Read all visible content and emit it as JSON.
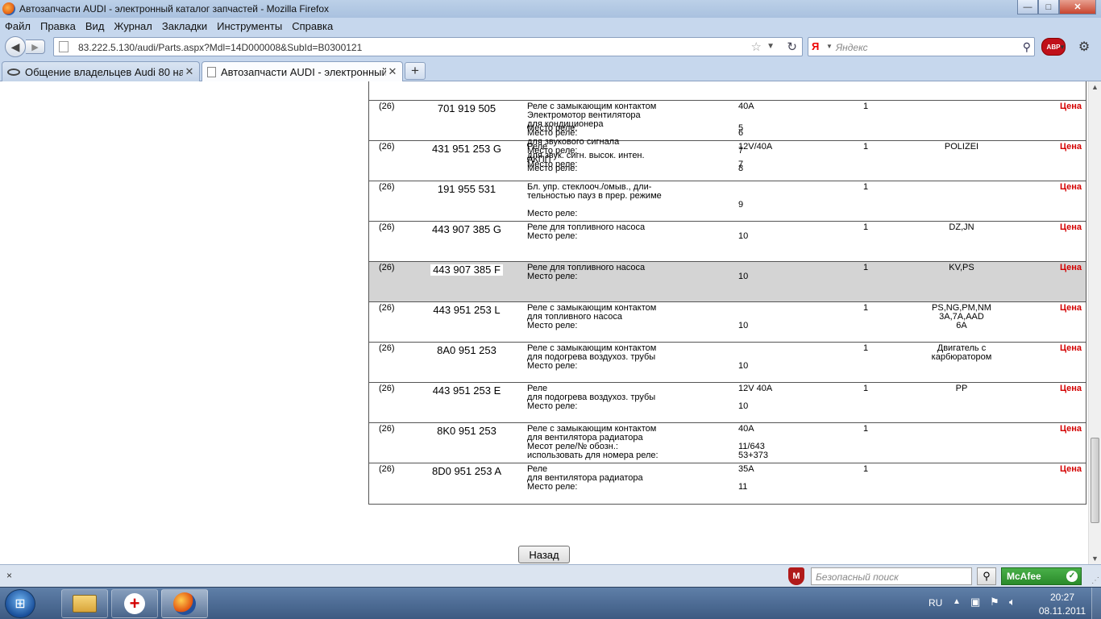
{
  "window": {
    "title": "Автозапчасти AUDI - электронный каталог запчастей - Mozilla Firefox",
    "minimize": "—",
    "maximize": "□",
    "close": "✕"
  },
  "menu": [
    "Файл",
    "Правка",
    "Вид",
    "Журнал",
    "Закладки",
    "Инструменты",
    "Справка"
  ],
  "nav": {
    "url": "83.222.5.130/audi/Parts.aspx?Mdl=14D000008&SubId=B0300121",
    "search_placeholder": "Яндекс",
    "search_engine_icon": "yandex-icon",
    "abp_label": "ABP"
  },
  "tabs": [
    {
      "label": "Общение владельцев Audi 80 на au...",
      "icon": "audi-rings-icon",
      "active": false
    },
    {
      "label": "Автозапчасти AUDI - электронный ...",
      "icon": "page-icon",
      "active": true
    }
  ],
  "table": {
    "rows": [
      {
        "ill": "",
        "num": "",
        "desc": [
          "",
          "",
          "",
          "",
          "",
          "",
          "",
          "Место реле:"
        ],
        "val": [
          "",
          "",
          "",
          "",
          "",
          "",
          "",
          "5"
        ],
        "qty": "",
        "note": [],
        "price": "",
        "selected": false
      },
      {
        "ill": "(26)",
        "num": "701 919 505",
        "desc": [
          "Реле с замыкающим контактом",
          "Электромотор вентилятора",
          "для кондиционера",
          "Место реле:",
          "для звукового сигнала",
          "Место реле:",
          "АКПП",
          "Место реле:"
        ],
        "val": [
          "40A",
          "",
          "",
          "6",
          "",
          "7",
          "",
          "8"
        ],
        "qty": "1",
        "note": [],
        "price": "Цена",
        "selected": false
      },
      {
        "ill": "(26)",
        "num": "431 951 253 G",
        "desc": [
          "Реле",
          "для звук. сигн. высок. интен.",
          "Место реле:"
        ],
        "val": [
          "12V/40A",
          "",
          "7"
        ],
        "qty": "1",
        "note": [
          "POLIZEI"
        ],
        "price": "Цена",
        "selected": false
      },
      {
        "ill": "(26)",
        "num": "191 955 531",
        "desc": [
          "Бл. упр. стеклооч./омыв., дли-",
          "тельностью пауз в прер. режиме",
          "",
          "Место реле:"
        ],
        "val": [
          "",
          "",
          "9",
          ""
        ],
        "qty": "1",
        "note": [],
        "price": "Цена",
        "selected": false
      },
      {
        "ill": "(26)",
        "num": "443 907 385 G",
        "desc": [
          "Реле для топливного насоса",
          "Место реле:"
        ],
        "val": [
          "",
          "10"
        ],
        "qty": "1",
        "note": [
          "DZ,JN"
        ],
        "price": "Цена",
        "selected": false
      },
      {
        "ill": "(26)",
        "num": "443 907 385 F",
        "desc": [
          "Реле для топливного насоса",
          "Место реле:"
        ],
        "val": [
          "",
          "10"
        ],
        "qty": "1",
        "note": [
          "KV,PS"
        ],
        "price": "Цена",
        "selected": true
      },
      {
        "ill": "(26)",
        "num": "443 951 253 L",
        "desc": [
          "Реле с замыкающим контактом",
          "для топливного насоса",
          "Место реле:"
        ],
        "val": [
          "",
          "",
          "10"
        ],
        "qty": "1",
        "note": [
          "PS,NG,PM,NM",
          "3A,7A,AAD",
          "6A"
        ],
        "price": "Цена",
        "selected": false
      },
      {
        "ill": "(26)",
        "num": "8A0 951 253",
        "desc": [
          "Реле с замыкающим контактом",
          "для подогрева воздухоз. трубы",
          "Место реле:"
        ],
        "val": [
          "",
          "",
          "10"
        ],
        "qty": "1",
        "note": [
          "Двигатель с",
          "карбюратором"
        ],
        "price": "Цена",
        "selected": false
      },
      {
        "ill": "(26)",
        "num": "443 951 253 E",
        "desc": [
          "Реле",
          "для подогрева воздухоз. трубы",
          "Место реле:"
        ],
        "val": [
          "12V 40A",
          "",
          "10"
        ],
        "qty": "1",
        "note": [
          "PP"
        ],
        "price": "Цена",
        "selected": false
      },
      {
        "ill": "(26)",
        "num": "8K0 951 253",
        "desc": [
          "Реле с замыкающим контактом",
          "для вентилятора радиатора",
          "Месот реле/№ обозн.:",
          "использовать для номера реле:"
        ],
        "val": [
          "40A",
          "",
          "11/643",
          "53+373"
        ],
        "qty": "1",
        "note": [],
        "price": "Цена",
        "selected": false
      },
      {
        "ill": "(26)",
        "num": "8D0 951 253 A",
        "desc": [
          "Реле",
          "для вентилятора радиатора",
          "Место реле:"
        ],
        "val": [
          "35A",
          "",
          "11"
        ],
        "qty": "1",
        "note": [],
        "price": "Цена",
        "selected": false
      }
    ]
  },
  "page": {
    "back_button": "Назад"
  },
  "addonbar": {
    "close": "×",
    "safe_search_placeholder": "Безопасный поиск",
    "mcafee_label": "McAfee",
    "mcafee_shield": "M"
  },
  "taskbar": {
    "language": "RU",
    "time": "20:27",
    "date": "08.11.2011"
  }
}
